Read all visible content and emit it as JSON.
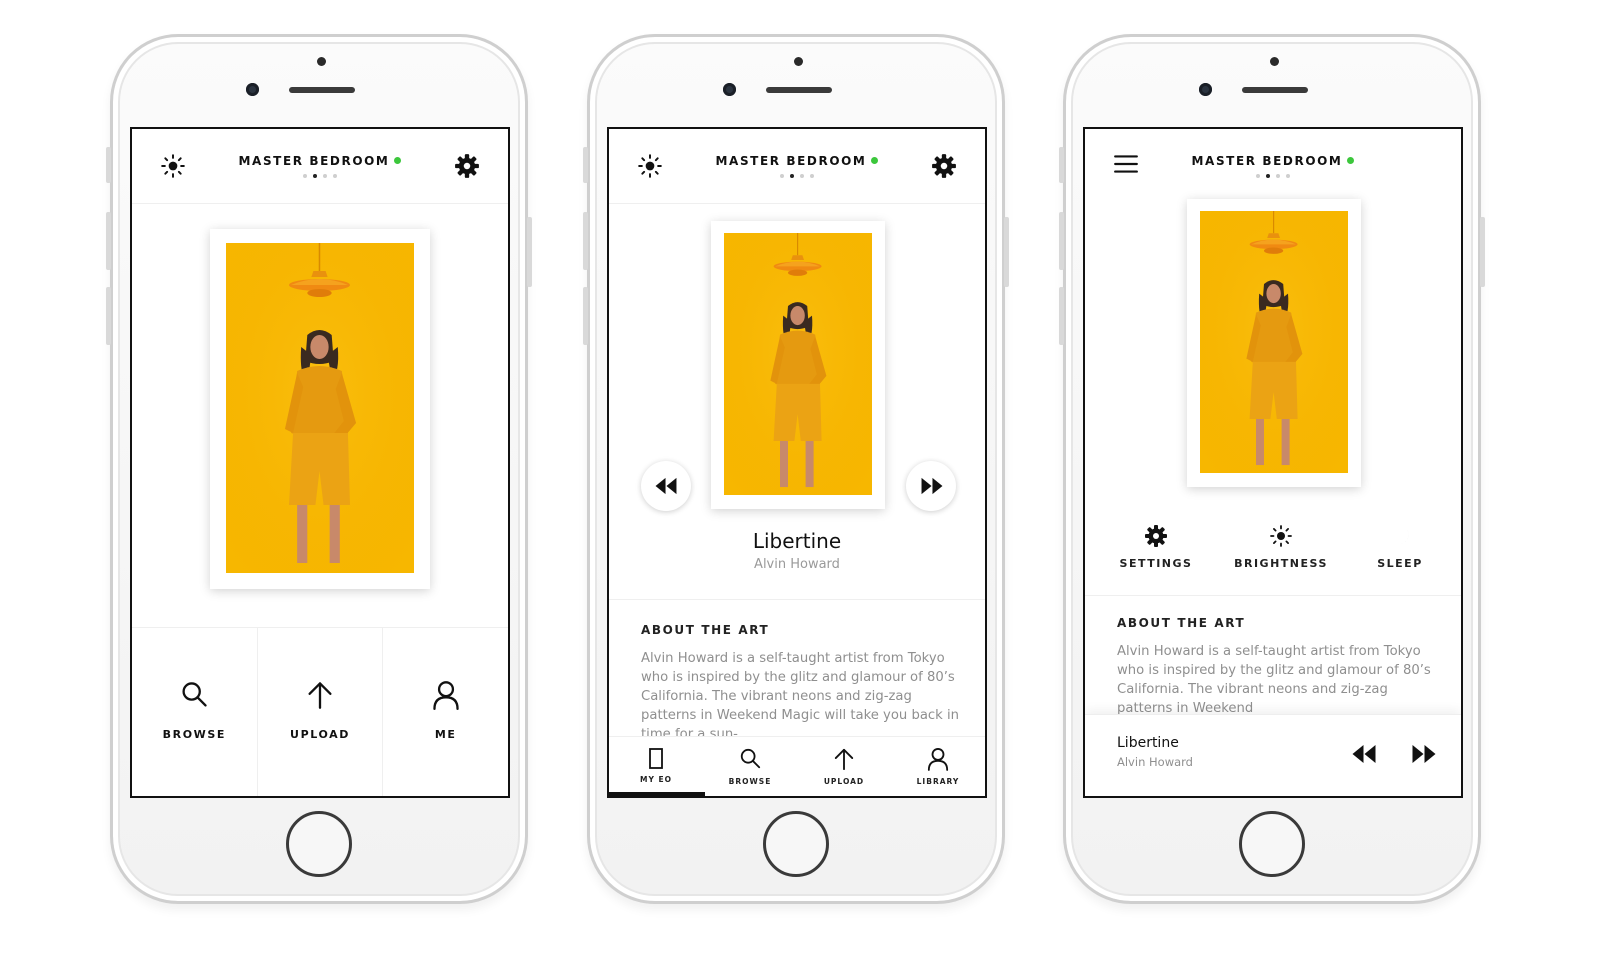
{
  "colors": {
    "art_yellow": "#f7b700",
    "status_green": "#3cc73c",
    "text_dark": "#111111",
    "text_muted": "#8f8f8f"
  },
  "screens": [
    {
      "header": {
        "title": "MASTER BEDROOM",
        "left_icon": "brightness-icon",
        "right_icon": "gear-icon",
        "page_dots": 4,
        "active_dot": 2
      },
      "nav": [
        {
          "label": "BROWSE",
          "icon": "search-icon"
        },
        {
          "label": "UPLOAD",
          "icon": "upload-arrow-icon"
        },
        {
          "label": "ME",
          "icon": "person-icon"
        }
      ]
    },
    {
      "header": {
        "title": "MASTER BEDROOM",
        "left_icon": "brightness-icon",
        "right_icon": "gear-icon",
        "page_dots": 4,
        "active_dot": 2
      },
      "now_playing": {
        "title": "Libertine",
        "artist": "Alvin Howard"
      },
      "about": {
        "heading": "ABOUT THE ART",
        "text": "Alvin Howard is a self-taught artist from Tokyo who is inspired by the glitz and glamour of 80’s California. The vibrant neons and zig-zag patterns in Weekend Magic will take you back in time for a sun-"
      },
      "tabs": [
        {
          "label": "MY EO",
          "icon": "frame-icon",
          "active": true
        },
        {
          "label": "BROWSE",
          "icon": "search-icon"
        },
        {
          "label": "UPLOAD",
          "icon": "upload-arrow-icon"
        },
        {
          "label": "LIBRARY",
          "icon": "person-icon"
        }
      ]
    },
    {
      "header": {
        "title": "MASTER BEDROOM",
        "left_icon": "menu-icon",
        "page_dots": 4,
        "active_dot": 2
      },
      "quick_actions": [
        {
          "label": "SETTINGS",
          "icon": "gear-icon"
        },
        {
          "label": "BRIGHTNESS",
          "icon": "brightness-icon"
        },
        {
          "label": "SLEEP",
          "icon": "moon-icon"
        }
      ],
      "about": {
        "heading": "ABOUT THE ART",
        "text": "Alvin Howard is a self-taught artist from Tokyo who is inspired by the glitz and glamour of 80’s California. The vibrant neons and zig-zag patterns in Weekend"
      },
      "mini_player": {
        "title": "Libertine",
        "artist": "Alvin Howard"
      }
    }
  ]
}
